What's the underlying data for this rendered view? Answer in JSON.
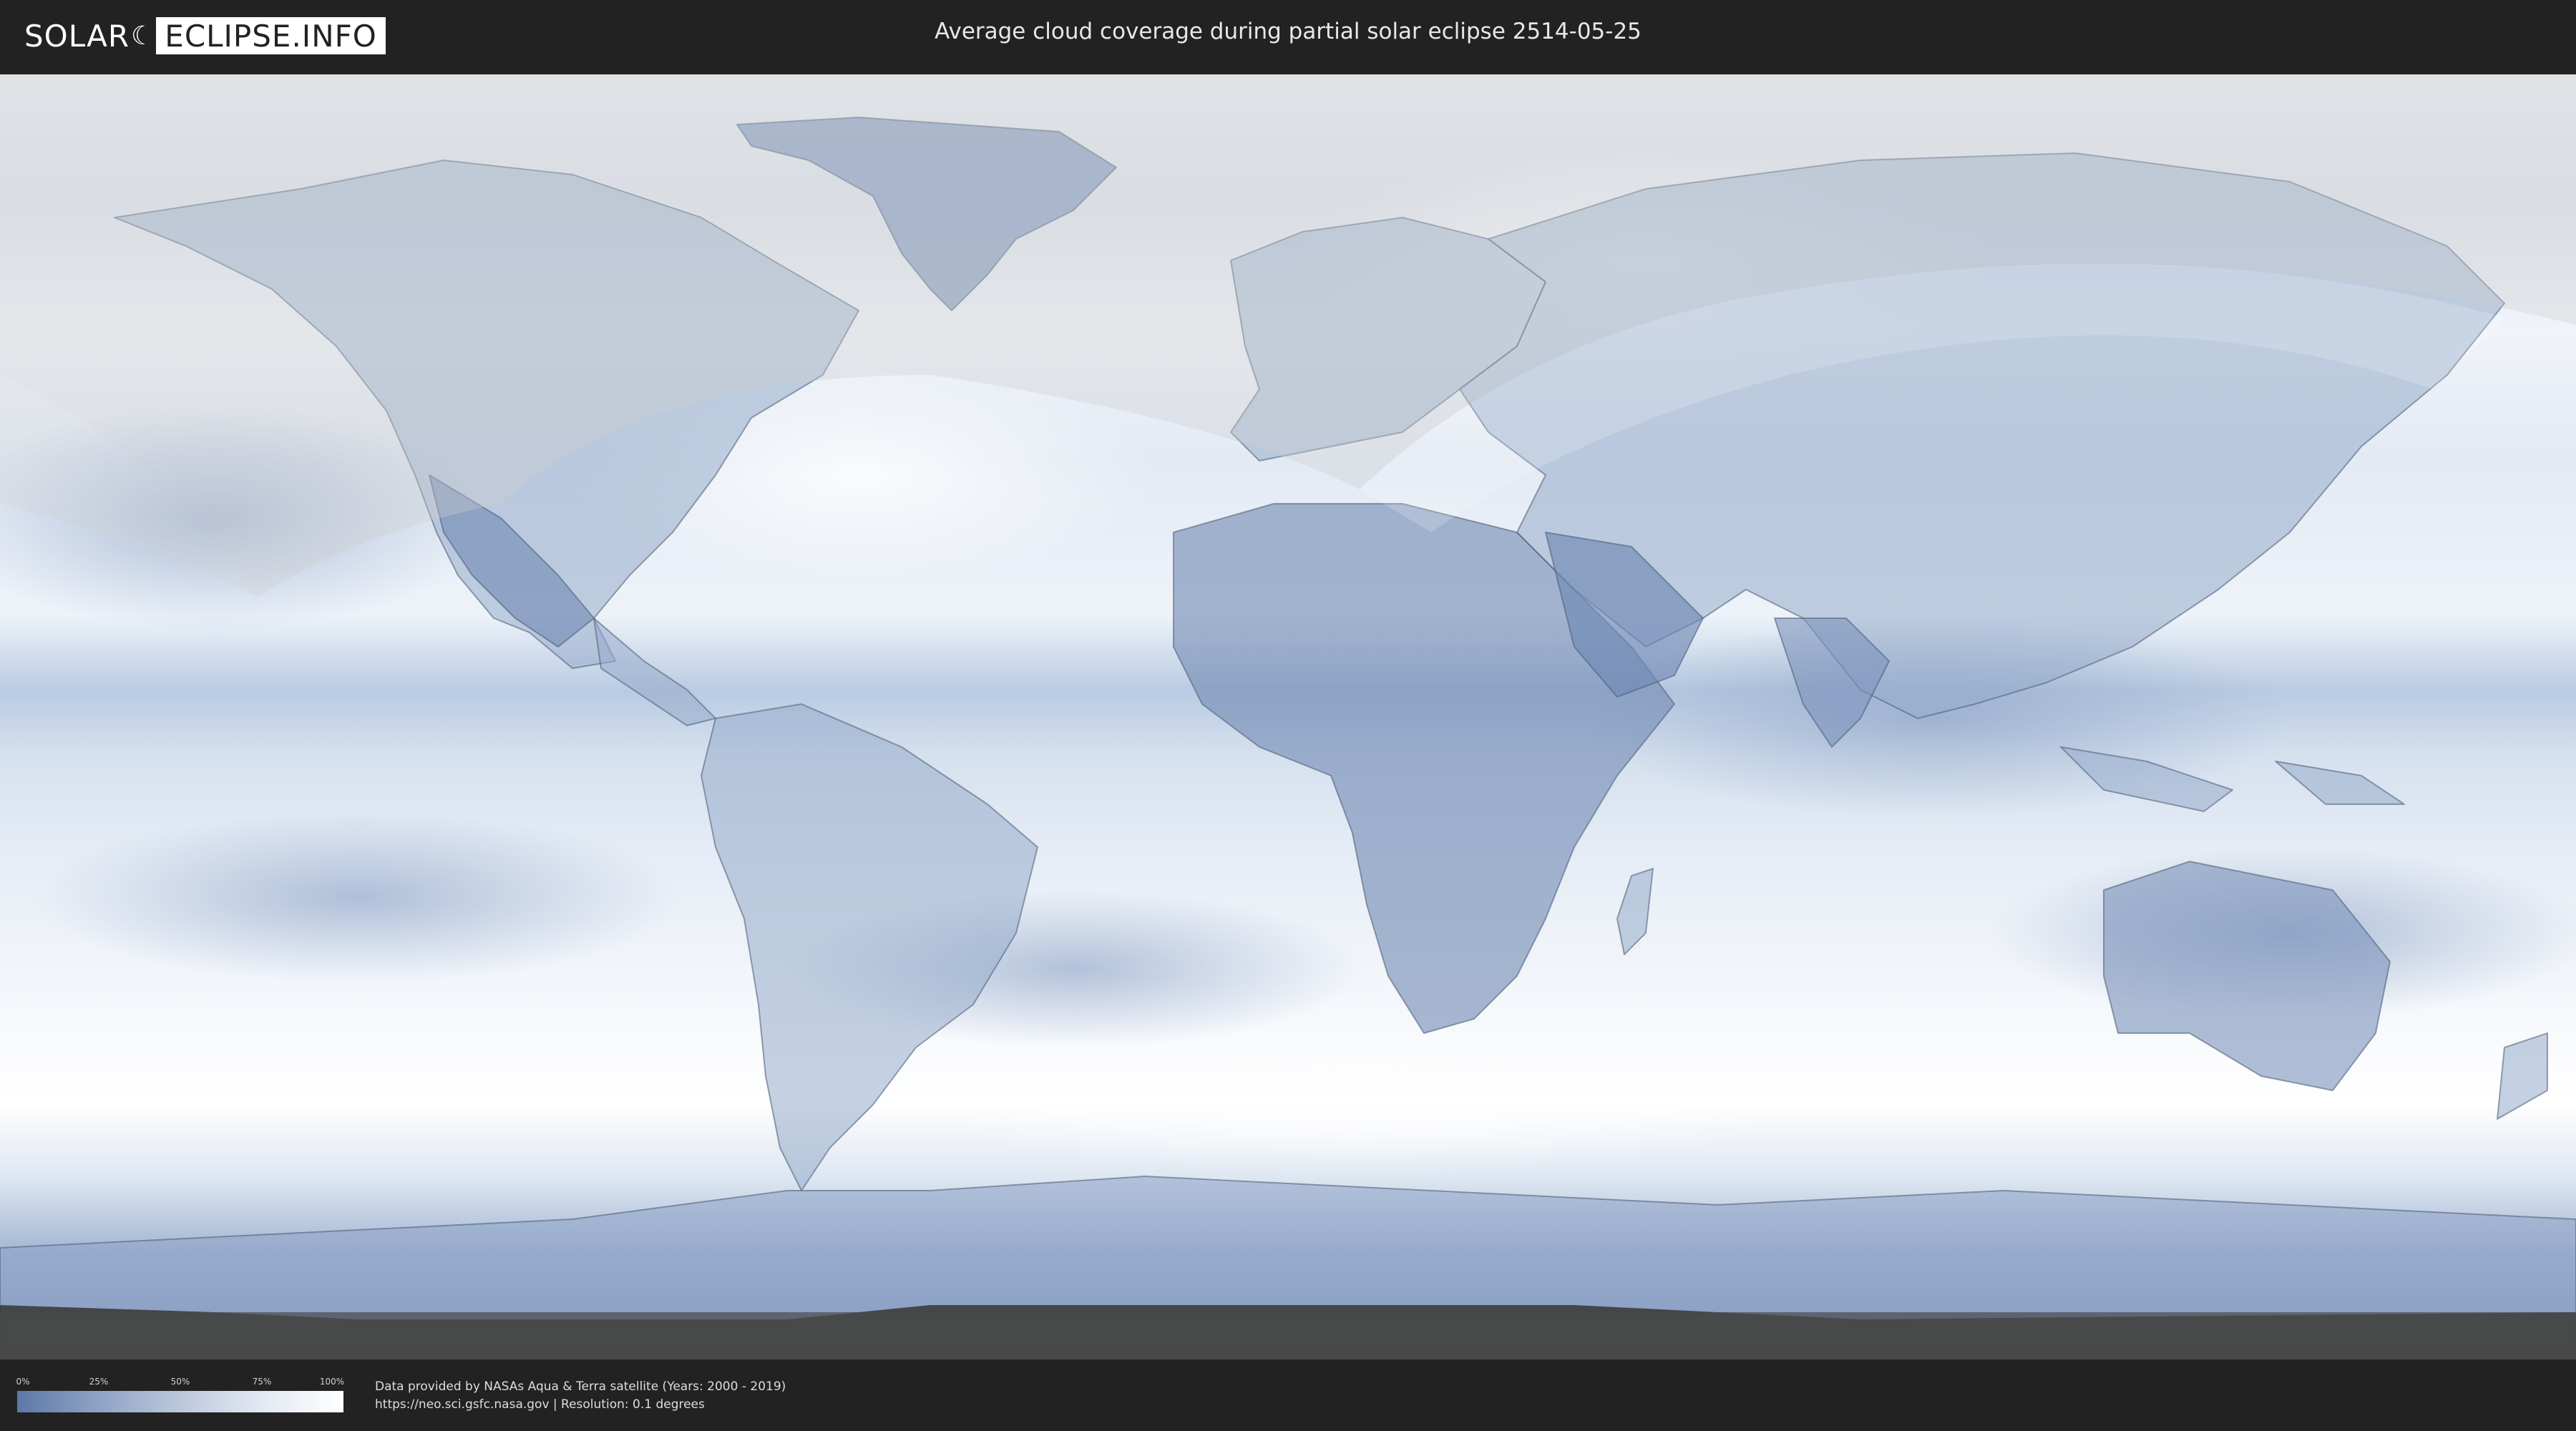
{
  "header": {
    "logo_left": "SOLAR",
    "logo_right": "ECLIPSE.INFO",
    "title": "Average cloud coverage during partial solar eclipse 2514-05-25"
  },
  "legend": {
    "ticks": [
      "0%",
      "25%",
      "50%",
      "75%",
      "100%"
    ],
    "colors": {
      "low": "#5d78a8",
      "high": "#ffffff"
    }
  },
  "footer": {
    "credit_line1": "Data provided by NASAs Aqua & Terra satellite (Years: 2000 - 2019)",
    "credit_line2": "https://neo.sci.gsfc.nasa.gov | Resolution: 0.1 degrees"
  },
  "map": {
    "projection": "equirectangular",
    "layer": "average-cloud-coverage",
    "eclipse_visibility_overlay": true,
    "colors": {
      "cloud_clear": "#5d78a8",
      "cloud_full": "#ffffff",
      "overlay_shade": "#cfcfcf",
      "continent_border": "#4a5a72",
      "polar_band": "#3c3c3c"
    }
  }
}
